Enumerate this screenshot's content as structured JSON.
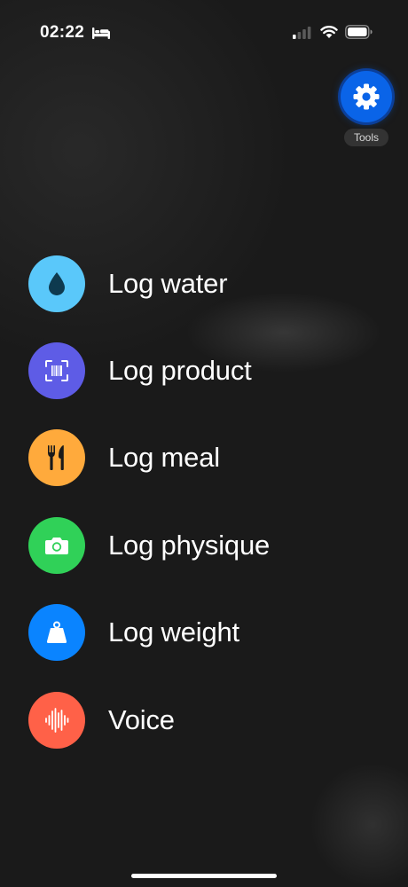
{
  "status_bar": {
    "time": "02:22",
    "icons": [
      "bed-icon",
      "cellular-signal-icon",
      "wifi-icon",
      "battery-icon"
    ]
  },
  "tools": {
    "label": "Tools",
    "icon": "gear-icon",
    "color": "#0a64e8"
  },
  "menu": {
    "items": [
      {
        "label": "Log water",
        "icon": "water-drop-icon",
        "color": "#5ac8fa"
      },
      {
        "label": "Log product",
        "icon": "barcode-scan-icon",
        "color": "#5e5ce6"
      },
      {
        "label": "Log meal",
        "icon": "fork-knife-icon",
        "color": "#ffaa3c"
      },
      {
        "label": "Log physique",
        "icon": "camera-icon",
        "color": "#30d158"
      },
      {
        "label": "Log weight",
        "icon": "scale-weight-icon",
        "color": "#0a84ff"
      },
      {
        "label": "Voice",
        "icon": "waveform-icon",
        "color": "#ff6148"
      }
    ]
  }
}
